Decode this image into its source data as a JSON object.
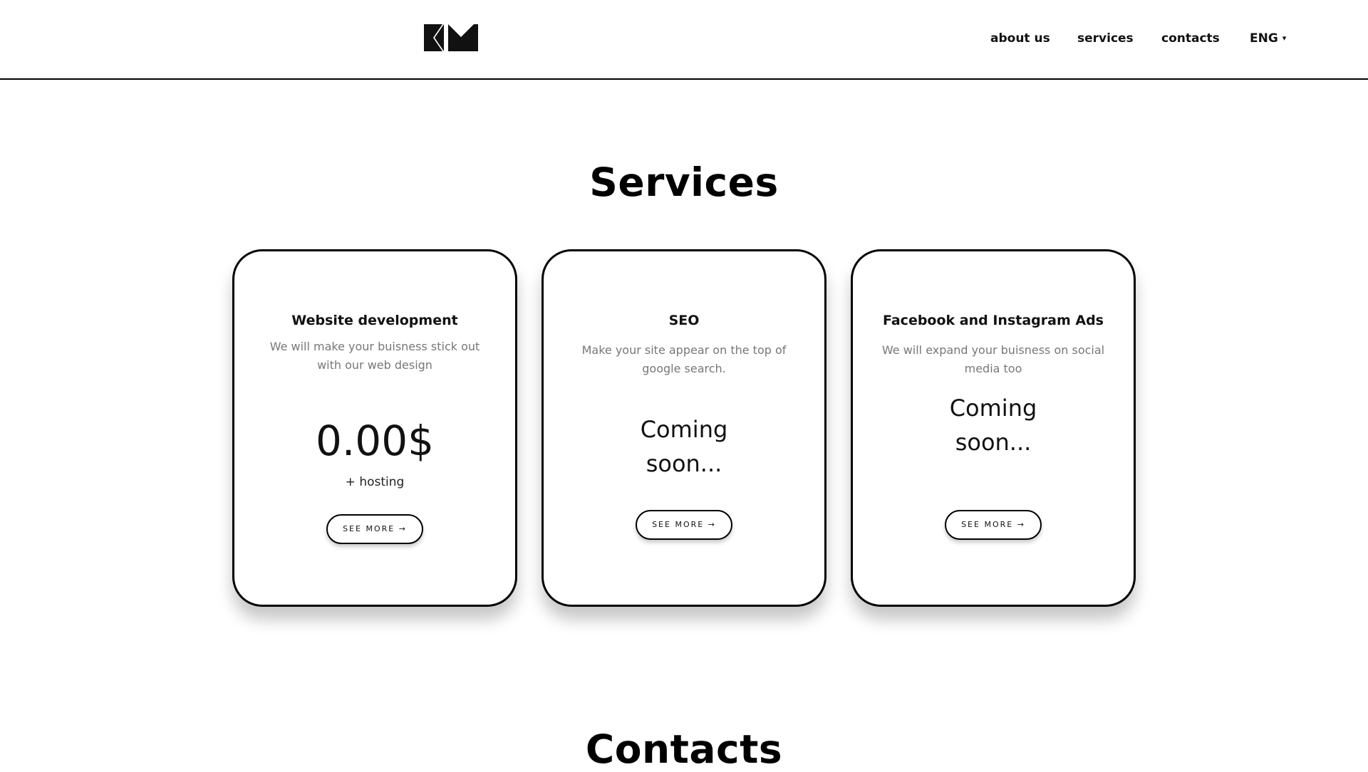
{
  "header": {
    "logo_text": "KM",
    "nav": {
      "about": "about us",
      "services": "services",
      "contacts": "contacts",
      "lang": "ENG",
      "lang_caret": "▾"
    }
  },
  "services": {
    "title": "Services",
    "cards": [
      {
        "title": "Website development",
        "desc": "We will make your buisness stick out with our web design",
        "price": "0.00$",
        "sub": "+ hosting",
        "button": "SEE MORE →"
      },
      {
        "title": "SEO",
        "desc": "Make your site appear on the top of google search.",
        "soon_line1": "Coming",
        "soon_line2": "soon...",
        "button": "SEE MORE →"
      },
      {
        "title": "Facebook and Instagram Ads",
        "desc": "We will expand your buisness on social media too",
        "soon_line1": "Coming",
        "soon_line2": "soon...",
        "button": "SEE MORE →"
      }
    ]
  },
  "contacts": {
    "title": "Contacts"
  }
}
